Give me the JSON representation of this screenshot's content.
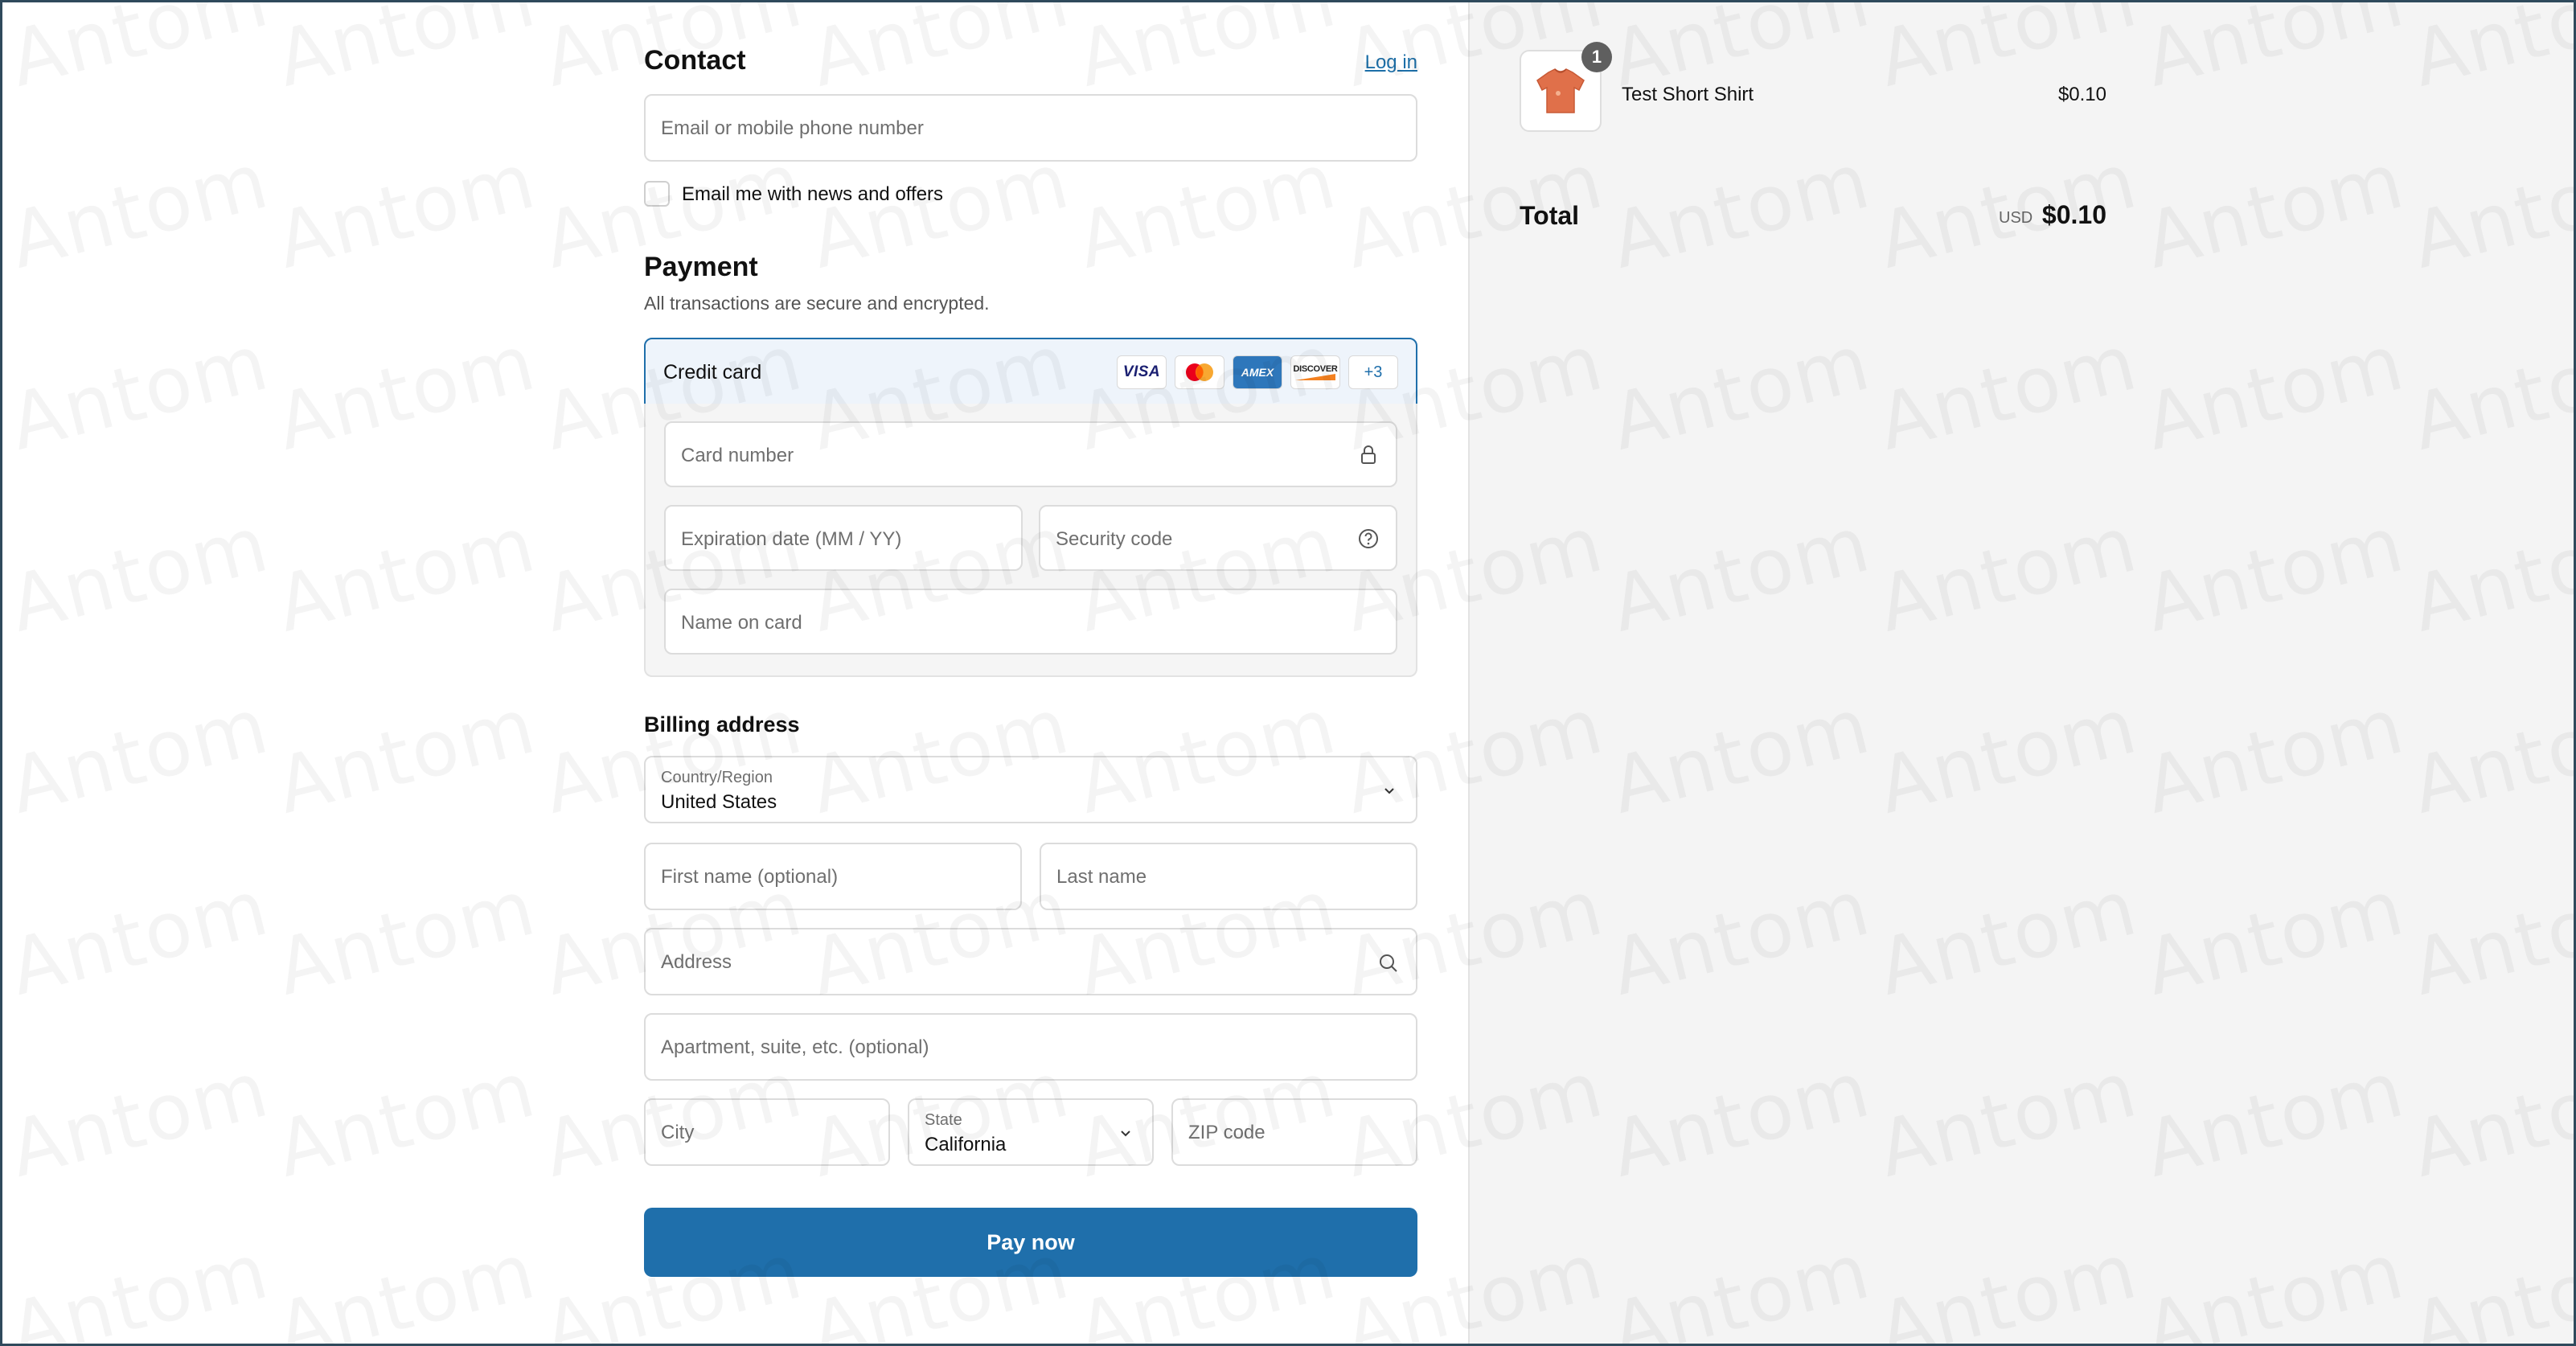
{
  "contact": {
    "title": "Contact",
    "login_link": "Log in",
    "email_placeholder": "Email or mobile phone number",
    "newsletter_label": "Email me with news and offers"
  },
  "payment": {
    "title": "Payment",
    "subtitle": "All transactions are secure and encrypted.",
    "method_label": "Credit card",
    "card_brands": [
      "VISA",
      "Mastercard",
      "AMEX",
      "DISCOVER"
    ],
    "more_brands": "+3",
    "card_number_placeholder": "Card number",
    "expiry_placeholder": "Expiration date (MM / YY)",
    "security_code_placeholder": "Security code",
    "name_on_card_placeholder": "Name on card"
  },
  "billing": {
    "title": "Billing address",
    "country_label": "Country/Region",
    "country_value": "United States",
    "first_name_placeholder": "First name (optional)",
    "last_name_placeholder": "Last name",
    "address_placeholder": "Address",
    "apartment_placeholder": "Apartment, suite, etc. (optional)",
    "city_placeholder": "City",
    "state_label": "State",
    "state_value": "California",
    "zip_placeholder": "ZIP code"
  },
  "pay_button": "Pay now",
  "summary": {
    "item": {
      "quantity": "1",
      "name": "Test Short Shirt",
      "price": "$0.10"
    },
    "total_label": "Total",
    "total_currency": "USD",
    "total_value": "$0.10"
  },
  "watermark": "Antom",
  "colors": {
    "accent": "#1f6fab",
    "summary_bg": "#f4f4f4",
    "selected_method_bg": "#eef4fb"
  }
}
